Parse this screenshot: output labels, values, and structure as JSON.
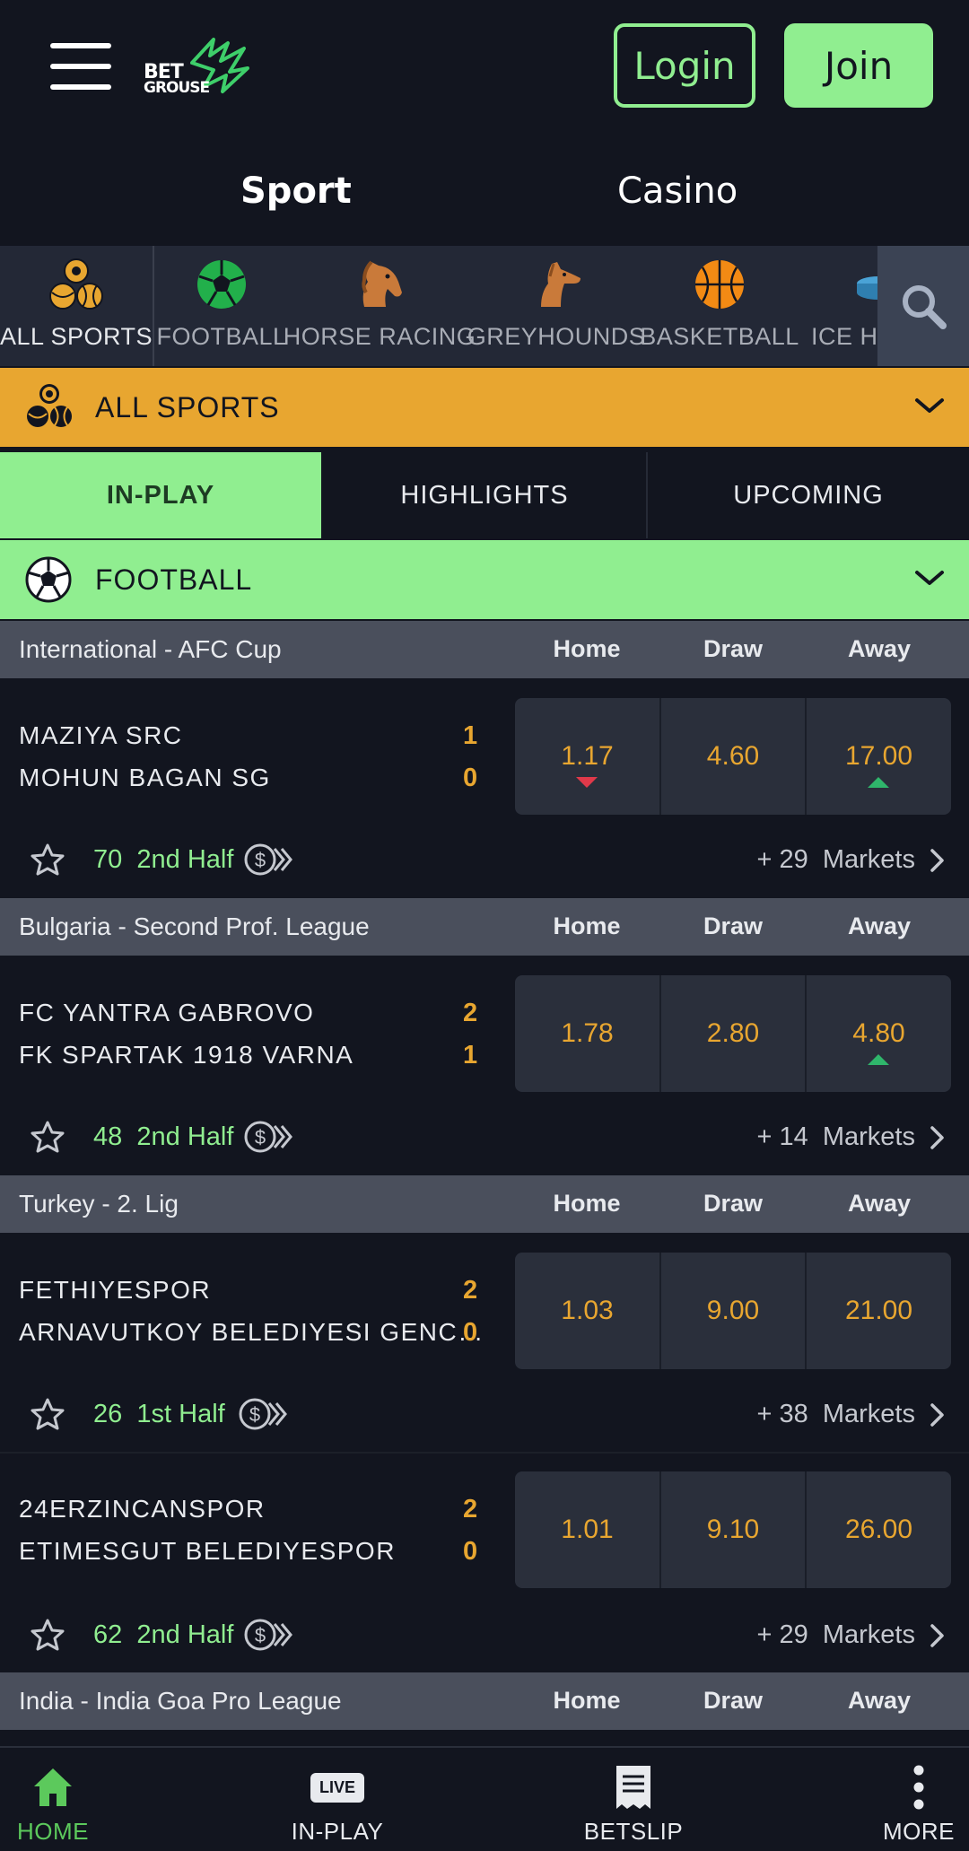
{
  "brand": {
    "line1": "BET",
    "line2": "GROUSE",
    "accent": "#90ee90"
  },
  "header": {
    "login_label": "Login",
    "join_label": "Join"
  },
  "top_tabs": [
    {
      "label": "Sport"
    },
    {
      "label": "Casino"
    }
  ],
  "sports": [
    {
      "label": "ALL SPORTS",
      "icon": "all-sports-icon"
    },
    {
      "label": "FOOTBALL",
      "icon": "football-icon"
    },
    {
      "label": "HORSE RACING",
      "icon": "horse-icon"
    },
    {
      "label": "GREYHOUNDS",
      "icon": "greyhound-icon"
    },
    {
      "label": "BASKETBALL",
      "icon": "basketball-icon"
    },
    {
      "label": "ICE HOCKEY",
      "icon": "ice-hockey-icon"
    }
  ],
  "filter": {
    "label": "ALL SPORTS"
  },
  "mode_tabs": [
    {
      "label": "IN-PLAY"
    },
    {
      "label": "HIGHLIGHTS"
    },
    {
      "label": "UPCOMING"
    }
  ],
  "sport_section": {
    "label": "FOOTBALL"
  },
  "columns": {
    "home": "Home",
    "draw": "Draw",
    "away": "Away"
  },
  "leagues": [
    {
      "name": "International - AFC Cup",
      "matches": [
        {
          "home": "MAZIYA SRC",
          "away": "MOHUN BAGAN SG",
          "home_score": "1",
          "away_score": "0",
          "odds": [
            "1.17",
            "4.60",
            "17.00"
          ],
          "minute": "70",
          "period": "2nd Half",
          "markets_count": "+ 29",
          "markets_label": "Markets"
        }
      ]
    },
    {
      "name": "Bulgaria - Second Prof. League",
      "matches": [
        {
          "home": "FC YANTRA GABROVO",
          "away": "FK SPARTAK 1918 VARNA",
          "home_score": "2",
          "away_score": "1",
          "odds": [
            "1.78",
            "2.80",
            "4.80"
          ],
          "minute": "48",
          "period": "2nd Half",
          "markets_count": "+ 14",
          "markets_label": "Markets"
        }
      ]
    },
    {
      "name": "Turkey - 2. Lig",
      "matches": [
        {
          "home": "FETHIYESPOR",
          "away": "ARNAVUTKOY BELEDIYESI GENC…",
          "home_score": "2",
          "away_score": "0",
          "odds": [
            "1.03",
            "9.00",
            "21.00"
          ],
          "minute": "26",
          "period": "1st Half",
          "markets_count": "+ 38",
          "markets_label": "Markets"
        },
        {
          "home": "24ERZINCANSPOR",
          "away": "ETIMESGUT BELEDIYESPOR",
          "home_score": "2",
          "away_score": "0",
          "odds": [
            "1.01",
            "9.10",
            "26.00"
          ],
          "minute": "62",
          "period": "2nd Half",
          "markets_count": "+ 29",
          "markets_label": "Markets"
        }
      ]
    },
    {
      "name": "India - India Goa Pro League",
      "matches": []
    }
  ],
  "bottom_nav": [
    {
      "label": "HOME",
      "icon": "home-icon"
    },
    {
      "label": "IN-PLAY",
      "icon": "live-icon",
      "badge": "LIVE"
    },
    {
      "label": "BETSLIP",
      "icon": "betslip-icon"
    },
    {
      "label": "MORE",
      "icon": "more-icon"
    }
  ]
}
